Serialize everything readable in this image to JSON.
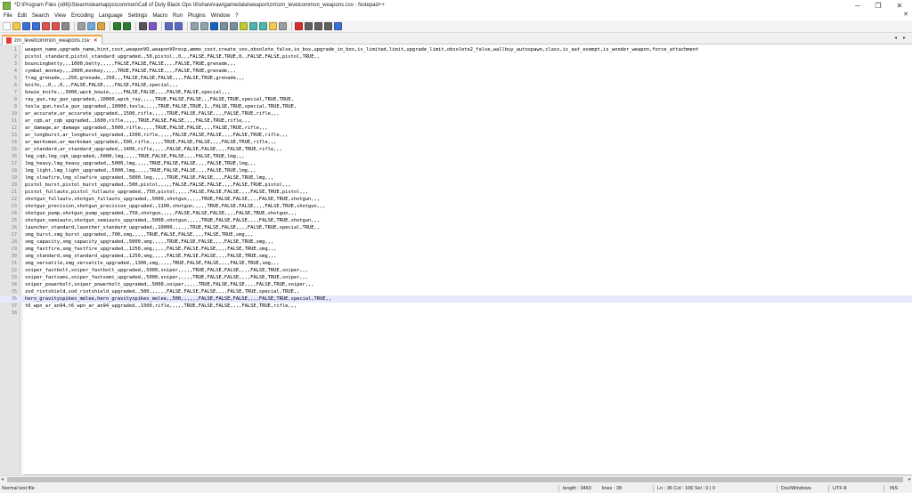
{
  "window": {
    "title": "*D:\\Program Files (x86)\\Steam\\steamapps\\common\\Call of Duty Black Ops III\\share\\raw\\gamedata\\weapon\\zm\\zm_levelcommon_weapons.csv - Notepad++",
    "minimize_glyph": "─",
    "maximize_glyph": "❐",
    "close_glyph": "✕"
  },
  "menu": {
    "items": [
      "File",
      "Edit",
      "Search",
      "View",
      "Encoding",
      "Language",
      "Settings",
      "Macro",
      "Run",
      "Plugins",
      "Window",
      "?"
    ],
    "doc_close": "✕"
  },
  "tab": {
    "label": "zm_levelcommon_weapons.csv",
    "close": "✕"
  },
  "toolbar": {
    "buttons": [
      {
        "name": "new-file",
        "color": "#ffffff"
      },
      {
        "name": "open-file",
        "color": "#f2c94c"
      },
      {
        "name": "save",
        "color": "#3a6fd8"
      },
      {
        "name": "save-all",
        "color": "#3a6fd8"
      },
      {
        "name": "close",
        "color": "#d9534f"
      },
      {
        "name": "close-all",
        "color": "#d9534f"
      },
      {
        "name": "print",
        "color": "#8a8a8a"
      },
      {
        "name": "cut",
        "color": "#9e9e9e"
      },
      {
        "name": "copy",
        "color": "#6fa8dc"
      },
      {
        "name": "paste",
        "color": "#d9a441"
      },
      {
        "name": "undo",
        "color": "#2e7d32"
      },
      {
        "name": "redo",
        "color": "#2e7d32"
      },
      {
        "name": "find",
        "color": "#555555"
      },
      {
        "name": "replace",
        "color": "#7e57c2"
      },
      {
        "name": "zoom-in",
        "color": "#5c6bc0"
      },
      {
        "name": "zoom-out",
        "color": "#5c6bc0"
      },
      {
        "name": "sync-vertical",
        "color": "#90a4ae"
      },
      {
        "name": "sync-horizontal",
        "color": "#90a4ae"
      },
      {
        "name": "word-wrap",
        "color": "#1565c0"
      },
      {
        "name": "show-all-chars",
        "color": "#78909c"
      },
      {
        "name": "indent-guide",
        "color": "#78909c"
      },
      {
        "name": "user-lang",
        "color": "#c0ca33"
      },
      {
        "name": "doc-map",
        "color": "#4db6ac"
      },
      {
        "name": "function-list",
        "color": "#4db6ac"
      },
      {
        "name": "folder-workspace",
        "color": "#f2c94c"
      },
      {
        "name": "monitoring",
        "color": "#9e9e9e"
      },
      {
        "name": "record-macro",
        "color": "#d32f2f"
      },
      {
        "name": "stop-record",
        "color": "#616161"
      },
      {
        "name": "play-macro",
        "color": "#616161"
      },
      {
        "name": "run-macro-multiple",
        "color": "#616161"
      },
      {
        "name": "save-macro",
        "color": "#3a6fd8"
      }
    ]
  },
  "editor": {
    "current_line": 36,
    "lines": [
      "weapon_name,upgrade_name,hint,cost,weaponVO,weaponVOresp,ammo_cost,create_vox,obsolete_false,in_box,upgrade_in_box,is_limited,limit,upgrade_limit,obsolete2_false,wallbuy_autospawn,class,is_aat_exempt,is_wonder_weapon,force_attachment",
      "pistol_standard,pistol_standard_upgraded,,50,pistol,,0,,,FALSE,FALSE,TRUE,0,,FALSE,FALSE,pistol,TRUE,,",
      "bouncingbetty,,,1000,betty,,,,,FALSE,FALSE,FALSE,,,,FALSE,TRUE,grenade,,,",
      "cymbal_monkey,,,2000,monkey,,,,,TRUE,FALSE,FALSE,,,,FALSE,TRUE,grenade,,,",
      "frag_grenade,,,250,grenade,,250,,,FALSE,FALSE,FALSE,,,,FALSE,TRUE,grenade,,,",
      "knife,,,0,,,0,,,FALSE,FALSE,,,,FALSE,FALSE,special,,,",
      "bowie_knife,,,3000,wpck_bowie,,,,,FALSE,FALSE,,,,FALSE,FALSE,special,,,",
      "ray_gun,ray_gun_upgraded,,10000,wpck_ray,,,,,TRUE,FALSE,FALSE,,,FALSE,TRUE,special,TRUE,TRUE,",
      "tesla_gun,tesla_gun_upgraded,,10000,tesla,,,,,TRUE,FALSE,TRUE,1,,FALSE,TRUE,special,TRUE,TRUE,",
      "ar_accurate,ar_accurate_upgraded,,1500,rifle,,,,,TRUE,FALSE,FALSE,,,,FALSE,TRUE,rifle,,,",
      "ar_cqb,ar_cqb_upgraded,,1600,rifle,,,,,TRUE,FALSE,FALSE,,,,FALSE,TRUE,rifle,,,",
      "ar_damage,ar_damage_upgraded,,5000,rifle,,,,,TRUE,FALSE,FALSE,,,,FALSE,TRUE,rifle,,,",
      "ar_longburst,ar_longburst_upgraded,,1500,rifle,,,,,FALSE,FALSE,FALSE,,,,FALSE,TRUE,rifle,,,",
      "ar_marksman,ar_marksman_upgraded,,500,rifle,,,,,TRUE,FALSE,FALSE,,,,FALSE,TRUE,rifle,,,",
      "ar_standard,ar_standard_upgraded,,1400,rifle,,,,,FALSE,FALSE,FALSE,,,,FALSE,TRUE,rifle,,,",
      "lmg_cqb,lmg_cqb_upgraded,,5000,lmg,,,,,TRUE,FALSE,FALSE,,,,FALSE,TRUE,lmg,,,",
      "lmg_heavy,lmg_heavy_upgraded,,5000,lmg,,,,,TRUE,FALSE,FALSE,,,,FALSE,TRUE,lmg,,,",
      "lmg_light,lmg_light_upgraded,,5000,lmg,,,,,TRUE,FALSE,FALSE,,,,FALSE,TRUE,lmg,,,",
      "lmg_slowfire,lmg_slowfire_upgraded,,5000,lmg,,,,,TRUE,FALSE,FALSE,,,,FALSE,TRUE,lmg,,,",
      "pistol_burst,pistol_burst_upgraded,,500,pistol,,,,,FALSE,FALSE,FALSE,,,,FALSE,TRUE,pistol,,,",
      "pistol_fullauto,pistol_fullauto_upgraded,,750,pistol,,,,,FALSE,FALSE,FALSE,,,,FALSE,TRUE,pistol,,,",
      "shotgun_fullauto,shotgun_fullauto_upgraded,,5000,shotgun,,,,,TRUE,FALSE,FALSE,,,,FALSE,TRUE,shotgun,,,",
      "shotgun_precision,shotgun_precision_upgraded,,1100,shotgun,,,,,TRUE,FALSE,FALSE,,,,FALSE,TRUE,shotgun,,,",
      "shotgun_pump,shotgun_pump_upgraded,,750,shotgun,,,,,FALSE,FALSE,FALSE,,,,FALSE,TRUE,shotgun,,,",
      "shotgun_semiauto,shotgun_semiauto_upgraded,,5000,shotgun,,,,,TRUE,FALSE,FALSE,,,,FALSE,TRUE,shotgun,,,",
      "launcher_standard,launcher_standard_upgraded,,10000,,,,,,TRUE,FALSE,FALSE,,,,FALSE,TRUE,special,TRUE,,",
      "smg_burst,smg_burst_upgraded,,700,smg,,,,,TRUE,FALSE,FALSE,,,,FALSE,TRUE,smg,,,",
      "smg_capacity,smg_capacity_upgraded,,5000,smg,,,,,TRUE,FALSE,FALSE,,,,FALSE,TRUE,smg,,,",
      "smg_fastfire,smg_fastfire_upgraded,,1250,smg,,,,,FALSE,FALSE,FALSE,,,,FALSE,TRUE,smg,,,",
      "smg_standard,smg_standard_upgraded,,1250,smg,,,,,FALSE,FALSE,FALSE,,,,FALSE,TRUE,smg,,,",
      "smg_versatile,smg_versatile_upgraded,,1300,smg,,,,,TRUE,FALSE,FALSE,,,,FALSE,TRUE,smg,,,",
      "sniper_fastbolt,sniper_fastbolt_upgraded,,5000,sniper,,,,,TRUE,FALSE,FALSE,,,,FALSE,TRUE,sniper,,,",
      "sniper_fastsemi,sniper_fastsemi_upgraded,,5000,sniper,,,,,TRUE,FALSE,FALSE,,,,FALSE,TRUE,sniper,,,",
      "sniper_powerbolt,sniper_powerbolt_upgraded,,5000,sniper,,,,,TRUE,FALSE,FALSE,,,,FALSE,TRUE,sniper,,,",
      "zod_riotshield,zod_riotshield_upgraded,,500,,,,,,FALSE,FALSE,FALSE,,,,FALSE,TRUE,special,TRUE,,",
      "hero_gravityspikes_melee,hero_gravityspikes_melee,,500,,,,,,FALSE,FALSE,FALSE,,,,FALSE,TRUE,special,TRUE,,",
      "t6_wpn_ar_an94,t6_wpn_ar_an94_upgraded,,1500,rifle,,,,,TRUE,FALSE,FALSE,,,,FALSE,TRUE,rifle,,,",
      ""
    ]
  },
  "scrollbar": {
    "left_arrow": "◂",
    "right_arrow": "▸"
  },
  "status": {
    "file_type": "Normal text file",
    "length": "length : 3463",
    "lines": "lines : 38",
    "position": "Ln : 36    Col : 106    Sel : 0 | 0",
    "eol": "Dos\\Windows",
    "encoding": "UTF-8",
    "mode": "INS"
  }
}
